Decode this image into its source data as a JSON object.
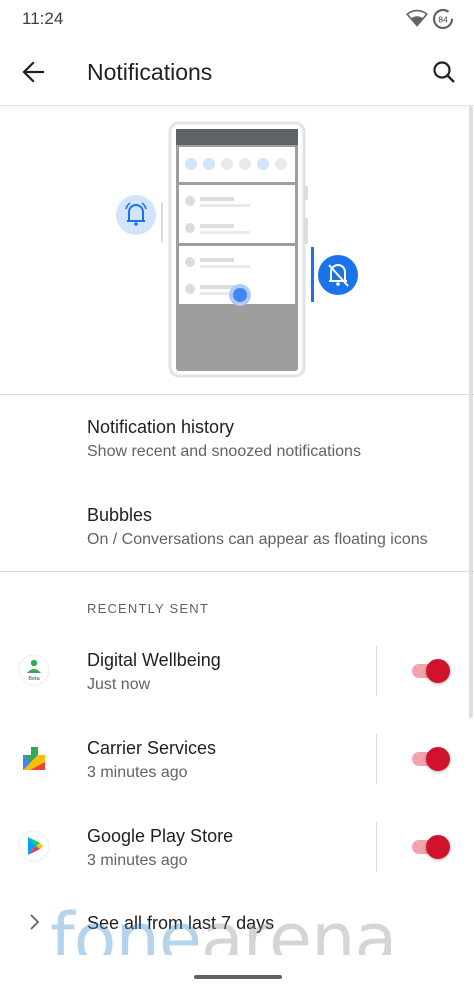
{
  "status_bar": {
    "time": "11:24",
    "battery_level": "84",
    "icons": [
      "wifi-icon",
      "battery-icon"
    ]
  },
  "app_bar": {
    "title": "Notifications",
    "back_icon": "arrow-back-icon",
    "search_icon": "search-icon"
  },
  "illustration": {
    "icons": [
      "bell-ringing-icon",
      "bell-off-icon"
    ]
  },
  "settings": {
    "history": {
      "title": "Notification history",
      "summary": "Show recent and snoozed notifications"
    },
    "bubbles": {
      "title": "Bubbles",
      "summary": "On / Conversations can appear as floating icons"
    }
  },
  "recently_sent": {
    "header": "RECENTLY SENT",
    "apps": [
      {
        "name": "Digital Wellbeing",
        "time": "Just now",
        "enabled": true,
        "icon": "digital-wellbeing-icon",
        "icon_badge": "Beta"
      },
      {
        "name": "Carrier Services",
        "time": "3 minutes ago",
        "enabled": true,
        "icon": "carrier-services-icon"
      },
      {
        "name": "Google Play Store",
        "time": "3 minutes ago",
        "enabled": true,
        "icon": "play-store-icon"
      }
    ],
    "see_all": "See all from last 7 days"
  },
  "watermark": {
    "part1": "fone",
    "part2": "arena"
  },
  "colors": {
    "accent": "#1a73e8",
    "toggle_on_thumb": "#d0122d",
    "toggle_on_track": "#f4a3ad",
    "text_primary": "#202124",
    "text_secondary": "#5f6368"
  }
}
